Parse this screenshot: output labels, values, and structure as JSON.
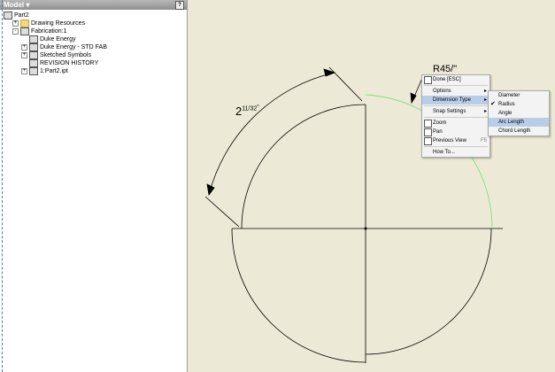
{
  "panel": {
    "title": "Model ▾",
    "tree": [
      {
        "label": "Part2",
        "indent": 0,
        "expander": ""
      },
      {
        "label": "Drawing Resources",
        "indent": 1,
        "expander": "+"
      },
      {
        "label": "Fabrication:1",
        "indent": 1,
        "expander": "-"
      },
      {
        "label": "Duke Energy",
        "indent": 2,
        "expander": ""
      },
      {
        "label": "Duke Energy - STD FAB",
        "indent": 2,
        "expander": "+"
      },
      {
        "label": "Sketched Symbols",
        "indent": 2,
        "expander": "+"
      },
      {
        "label": "REVISION HISTORY",
        "indent": 2,
        "expander": ""
      },
      {
        "label": "1:Part2.ipt",
        "indent": 2,
        "expander": "+"
      }
    ]
  },
  "canvas": {
    "dimension_whole": "2",
    "dimension_num": "11",
    "dimension_den": "32",
    "dimension_unit": "\"",
    "partial_dim": "R45/\""
  },
  "menu": {
    "items": [
      {
        "label": "Done [ESC]",
        "icon": "done-icon"
      },
      {
        "sep": true
      },
      {
        "label": "Options",
        "submenu": true
      },
      {
        "label": "Dimension Type",
        "submenu": true,
        "selected": true
      },
      {
        "sep": true
      },
      {
        "label": "Snap Settings",
        "submenu": true
      },
      {
        "sep": true
      },
      {
        "label": "Zoom",
        "icon": "zoom-icon"
      },
      {
        "label": "Pan",
        "icon": "pan-icon"
      },
      {
        "label": "Previous View",
        "icon": "previous-view-icon",
        "key": "F5"
      },
      {
        "sep": true
      },
      {
        "label": "How To..."
      }
    ]
  },
  "submenu": {
    "items": [
      {
        "label": "Diameter"
      },
      {
        "label": "Radius",
        "checked": true
      },
      {
        "label": "Angle"
      },
      {
        "label": "Arc Length",
        "selected": true
      },
      {
        "label": "Chord Length"
      }
    ]
  },
  "colors": {
    "highlight_arc": "#7ee07e",
    "menu_selected": "#b9cde8"
  }
}
